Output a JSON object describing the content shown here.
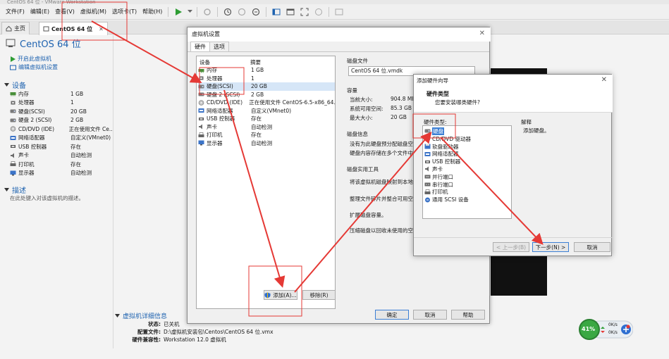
{
  "window": {
    "title": "CentOS 64 位 - VMware Workstation"
  },
  "menu": [
    "文件(F)",
    "编辑(E)",
    "查看(V)",
    "虚拟机(M)",
    "选项卡(T)",
    "帮助(H)"
  ],
  "tabs": {
    "home": "主页",
    "vm": "CentOS 64 位"
  },
  "vm": {
    "name": "CentOS 64 位",
    "power_on": "开启此虚拟机",
    "edit_settings": "编辑虚拟机设置",
    "devices_title": "设备",
    "devices": [
      {
        "icon": "memory-icon",
        "name": "内存",
        "value": "1 GB"
      },
      {
        "icon": "cpu-icon",
        "name": "处理器",
        "value": "1"
      },
      {
        "icon": "disk-icon",
        "name": "硬盘(SCSI)",
        "value": "20 GB"
      },
      {
        "icon": "disk-icon",
        "name": "硬盘 2 (SCSI)",
        "value": "2 GB"
      },
      {
        "icon": "cdrom-icon",
        "name": "CD/DVD (IDE)",
        "value": "正在使用文件 Ce..."
      },
      {
        "icon": "network-icon",
        "name": "网络适配器",
        "value": "自定义(VMnet0)"
      },
      {
        "icon": "usb-icon",
        "name": "USB 控制器",
        "value": "存在"
      },
      {
        "icon": "sound-icon",
        "name": "声卡",
        "value": "自动检测"
      },
      {
        "icon": "printer-icon",
        "name": "打印机",
        "value": "存在"
      },
      {
        "icon": "display-icon",
        "name": "显示器",
        "value": "自动检测"
      }
    ],
    "desc_title": "描述",
    "desc_hint": "在此处键入对该虚拟机的描述。",
    "details_title": "虚拟机详细信息",
    "details": [
      {
        "k": "状态:",
        "v": "已关机"
      },
      {
        "k": "配置文件:",
        "v": "D:\\虚拟机安装包\\Centos\\CentOS 64 位.vmx"
      },
      {
        "k": "硬件兼容性:",
        "v": "Workstation 12.0 虚拟机"
      }
    ]
  },
  "settings": {
    "title": "虚拟机设置",
    "tab_hw": "硬件",
    "tab_opt": "选项",
    "col_device": "设备",
    "col_summary": "摘要",
    "devices": [
      {
        "icon": "memory-icon",
        "name": "内存",
        "value": "1 GB"
      },
      {
        "icon": "cpu-icon",
        "name": "处理器",
        "value": "1"
      },
      {
        "icon": "disk-icon",
        "name": "硬盘(SCSI)",
        "value": "20 GB"
      },
      {
        "icon": "disk-icon",
        "name": "硬盘 2 (SCSI)",
        "value": "2 GB"
      },
      {
        "icon": "cdrom-icon",
        "name": "CD/DVD (IDE)",
        "value": "正在使用文件 CentOS-6.5-x86_64..."
      },
      {
        "icon": "network-icon",
        "name": "网络适配器",
        "value": "自定义(VMnet0)"
      },
      {
        "icon": "usb-icon",
        "name": "USB 控制器",
        "value": "存在"
      },
      {
        "icon": "sound-icon",
        "name": "声卡",
        "value": "自动检测"
      },
      {
        "icon": "printer-icon",
        "name": "打印机",
        "value": "存在"
      },
      {
        "icon": "display-icon",
        "name": "显示器",
        "value": "自动检测"
      }
    ],
    "diskfile_title": "磁盘文件",
    "diskfile_value": "CentOS 64 位.vmdk",
    "capacity_title": "容量",
    "cap_current_k": "当前大小:",
    "cap_current_v": "904.8 MB",
    "cap_free_k": "系统可用空间:",
    "cap_free_v": "85.3 GB",
    "cap_max_k": "最大大小:",
    "cap_max_v": "20 GB",
    "diskinfo_title": "磁盘信息",
    "diskinfo_1": "没有为此硬盘预分配磁盘空",
    "diskinfo_2": "硬盘内容存储在多个文件中",
    "util_title": "磁盘实用工具",
    "util_1": "将该虚拟机磁盘映射到本地",
    "util_2": "整理文件碎片并整合可用空",
    "util_3": "扩展磁盘容量。",
    "util_4": "压缩磁盘以回收未使用的空",
    "add_btn": "添加(A)...",
    "remove_btn": "移除(R)",
    "ok_btn": "确定",
    "cancel_btn": "取消",
    "help_btn": "帮助"
  },
  "wizard": {
    "title": "添加硬件向导",
    "heading": "硬件类型",
    "subheading": "您要安装哪类硬件?",
    "list_label": "硬件类型:",
    "explain_label": "解释",
    "explain_text": "添加硬盘。",
    "items": [
      {
        "icon": "disk-icon",
        "name": "硬盘"
      },
      {
        "icon": "cdrom-icon",
        "name": "CD/DVD 驱动器"
      },
      {
        "icon": "floppy-icon",
        "name": "软盘驱动器"
      },
      {
        "icon": "network-icon",
        "name": "网络适配器"
      },
      {
        "icon": "usb-icon",
        "name": "USB 控制器"
      },
      {
        "icon": "sound-icon",
        "name": "声卡"
      },
      {
        "icon": "parallel-port-icon",
        "name": "并行端口"
      },
      {
        "icon": "serial-port-icon",
        "name": "串行端口"
      },
      {
        "icon": "printer-icon",
        "name": "打印机"
      },
      {
        "icon": "scsi-icon",
        "name": "通用 SCSI 设备"
      }
    ],
    "back_btn": "< 上一步(B)",
    "next_btn": "下一步(N) >",
    "cancel_btn": "取消"
  },
  "gadget": {
    "percent": "41%",
    "up": "0K/s",
    "down": "0K/s"
  },
  "colors": {
    "accent": "#1f63b0",
    "annotation": "#e53935",
    "selection": "#3c7fd4"
  }
}
